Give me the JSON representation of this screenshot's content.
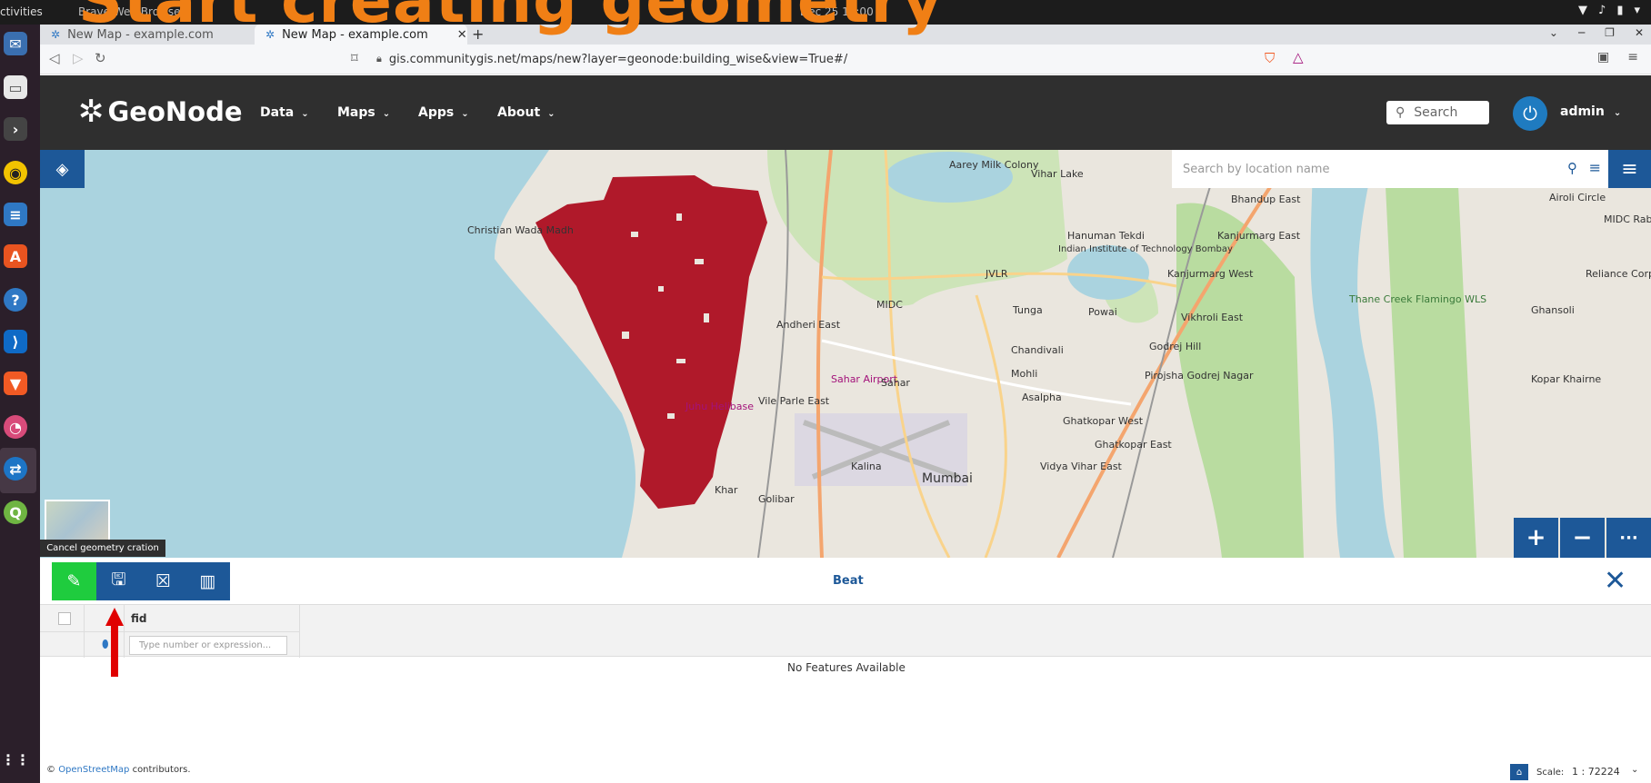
{
  "overlay_title": "Start creating geometry",
  "desktop": {
    "activities": "ctivities",
    "window_title": "Brave Web Browser",
    "clock": "Dec 25  10:00"
  },
  "browser": {
    "tabs": [
      {
        "label": "New Map - example.com",
        "active": false
      },
      {
        "label": "New Map - example.com",
        "active": true
      }
    ],
    "new_tab": "+",
    "url": "gis.communitygis.net/maps/new?layer=geonode:building_wise&view=True#/"
  },
  "geonode": {
    "brand": "GeoNode",
    "menu": [
      "Data",
      "Maps",
      "Apps",
      "About"
    ],
    "search_placeholder": "Search",
    "user": "admin"
  },
  "map": {
    "location_search_placeholder": "Search by location name",
    "labels": [
      "Aarey Milk Colony",
      "Vihar Lake",
      "Bhandup East",
      "Airoli Circle",
      "MIDC Rabale",
      "Christian Wada Madh",
      "Hanuman Tekdi",
      "Indian Institute of Technology Bombay",
      "Kanjurmarg East",
      "Kanjurmarg West",
      "Thane Creek Flamingo WLS",
      "Reliance Corporate Park",
      "JVLR",
      "MIDC",
      "Tunga",
      "Powai",
      "Ghansoli",
      "Andheri East",
      "Vikhroli East",
      "Chandivali",
      "Mohli",
      "Godrej Hill",
      "Pirojsha Godrej Nagar",
      "Sahar Airport",
      "Sahar",
      "Asalpha",
      "Kopar Khairne",
      "Vile Parle East",
      "Juhu Helibase",
      "Ghatkopar West",
      "Ghatkopar East",
      "Kalina",
      "Vidya Vihar East",
      "Mumbai",
      "Khar",
      "Golibar"
    ],
    "zoom_in": "+",
    "zoom_out": "−",
    "more": "···"
  },
  "tooltip": "Cancel geometry cration",
  "attribute_table": {
    "title": "Beat",
    "columns": [
      "fid"
    ],
    "filter_placeholder": "Type number or expression...",
    "empty_message": "No Features Available"
  },
  "footer": {
    "attribution_prefix": "© ",
    "attribution_link": "OpenStreetMap",
    "attribution_suffix": " contributors.",
    "scale_label": "Scale:",
    "scale_value": "1 : 72224"
  },
  "colors": {
    "primary": "#1d5898",
    "active_tool": "#1fcc3e",
    "overlay": "#f07f15",
    "layer_fill": "#b0192a",
    "annotation": "#e00000"
  }
}
